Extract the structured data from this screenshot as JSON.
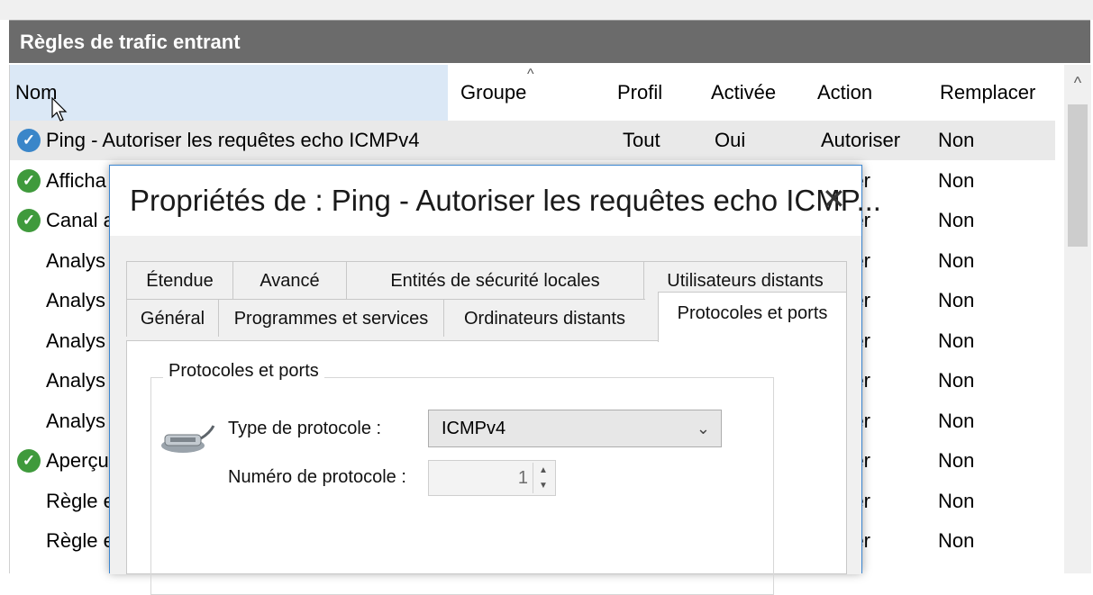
{
  "panel": {
    "title": "Règles de trafic entrant"
  },
  "columns": [
    {
      "label": "Nom",
      "sorted": true
    },
    {
      "label": "Groupe"
    },
    {
      "label": "Profil"
    },
    {
      "label": "Activée"
    },
    {
      "label": "Action"
    },
    {
      "label": "Remplacer"
    }
  ],
  "sort_arrow": "^",
  "rows": [
    {
      "icon": "check",
      "name": "Ping - Autoriser les requêtes echo ICMPv4",
      "profile": "Tout",
      "enabled": "Oui",
      "action": "Autoriser",
      "override": "Non",
      "selected": true
    },
    {
      "icon": "check",
      "name": "Afficha",
      "action": "oriser",
      "override": "Non"
    },
    {
      "icon": "check",
      "name": "Canal a",
      "action": "oriser",
      "override": "Non"
    },
    {
      "icon": "none",
      "name": "Analys",
      "action": "oriser",
      "override": "Non"
    },
    {
      "icon": "none",
      "name": "Analys",
      "action": "oriser",
      "override": "Non"
    },
    {
      "icon": "none",
      "name": "Analys",
      "action": "oriser",
      "override": "Non"
    },
    {
      "icon": "none",
      "name": "Analys",
      "action": "oriser",
      "override": "Non"
    },
    {
      "icon": "none",
      "name": "Analys",
      "action": "oriser",
      "override": "Non"
    },
    {
      "icon": "check",
      "name": "Aperçu",
      "action": "oriser",
      "override": "Non"
    },
    {
      "icon": "none",
      "name": "Règle e",
      "action": "oriser",
      "override": "Non"
    },
    {
      "icon": "none",
      "name": "Règle e",
      "action": "oriser",
      "override": "Non"
    }
  ],
  "dialog": {
    "title": "Propriétés de : Ping - Autoriser les requêtes echo ICMP...",
    "close_label": "✕",
    "tabs_row1": [
      "Étendue",
      "Avancé",
      "Entités de sécurité locales",
      "Utilisateurs distants"
    ],
    "tabs_row2": [
      "Général",
      "Programmes et services",
      "Ordinateurs distants",
      "Protocoles et ports"
    ],
    "active_tab": "Protocoles et ports",
    "group_label": "Protocoles et ports",
    "protocol_type_label": "Type de protocole :",
    "protocol_type_value": "ICMPv4",
    "protocol_number_label": "Numéro de protocole :",
    "protocol_number_value": "1"
  },
  "colors": {
    "title_bar": "#6b6b6b",
    "sorted_header": "#dbe8f6",
    "selected_row": "#e9e9e9",
    "check_green": "#3f9a3c",
    "dialog_border": "#3b85d0"
  }
}
